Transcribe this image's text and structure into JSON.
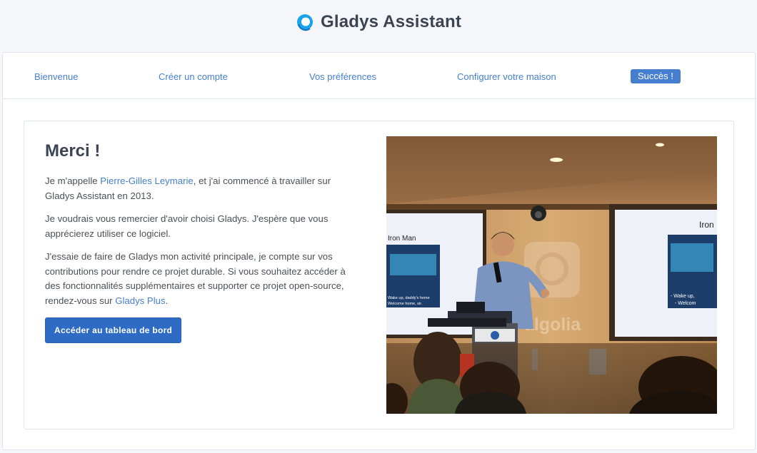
{
  "header": {
    "app_title": "Gladys Assistant",
    "logo_icon": "gladys-logo-icon"
  },
  "steps": [
    {
      "label": "Bienvenue",
      "active": false
    },
    {
      "label": "Créer un compte",
      "active": false
    },
    {
      "label": "Vos préférences",
      "active": false
    },
    {
      "label": "Configurer votre maison",
      "active": false
    },
    {
      "label": "Succès !",
      "active": true
    }
  ],
  "main": {
    "title": "Merci !",
    "p1_before": "Je m'appelle ",
    "p1_link": "Pierre-Gilles Leymarie",
    "p1_after": ", et j'ai commencé à travailler sur Gladys Assistant en 2013.",
    "p2": "Je voudrais vous remercier d'avoir choisi Gladys. J'espère que vous apprécierez utiliser ce logiciel.",
    "p3_before": "J'essaie de faire de Gladys mon activité principale, je compte sur vos contributions pour rendre ce projet durable. Si vous souhaitez accéder à des fonctionnalités supplémentaires et supporter ce projet open-source, rendez-vous sur ",
    "p3_link": "Gladys Plus",
    "p3_after": ".",
    "cta_label": "Accéder au tableau de bord"
  },
  "photo": {
    "left_screen_title": "Iron Man",
    "left_screen_caption_1": "Wake up, daddy's home",
    "left_screen_caption_2": "Welcome home, sir.",
    "right_screen_title": "Iron",
    "right_screen_caption_1": "- Wake up,",
    "right_screen_caption_2": "- Welcom",
    "wall_logo_text": "algolia"
  },
  "colors": {
    "accent": "#467fcf",
    "button": "#2d6bc4",
    "background": "#f4f6fa"
  }
}
